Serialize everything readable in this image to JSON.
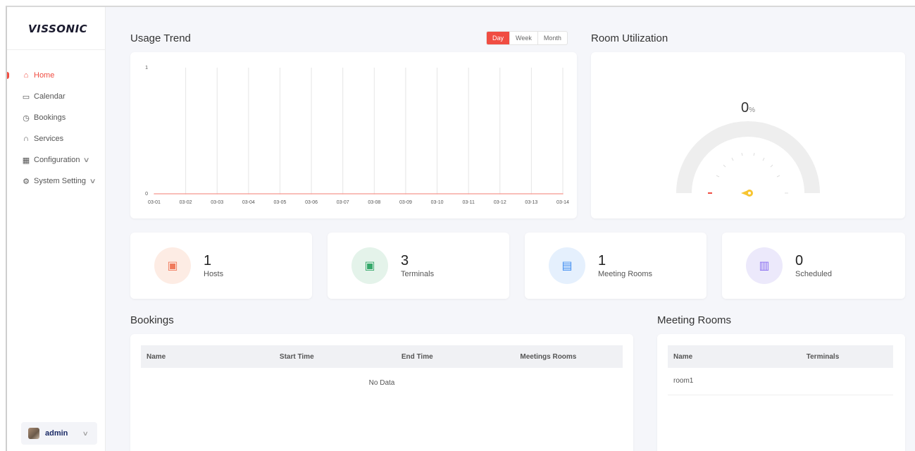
{
  "brand": {
    "logo": "VISSONIC"
  },
  "sidebar": {
    "items": [
      {
        "label": "Home",
        "icon": "home-icon",
        "glyph": "⌂",
        "active": true
      },
      {
        "label": "Calendar",
        "icon": "calendar-icon",
        "glyph": "▭",
        "active": false
      },
      {
        "label": "Bookings",
        "icon": "clock-icon",
        "glyph": "◷",
        "active": false
      },
      {
        "label": "Services",
        "icon": "headset-icon",
        "glyph": "∩",
        "active": false
      },
      {
        "label": "Configuration",
        "icon": "building-icon",
        "glyph": "▦",
        "active": false,
        "expandable": true
      },
      {
        "label": "System Setting",
        "icon": "settings-icon",
        "glyph": "⚙",
        "active": false,
        "expandable": true
      }
    ],
    "user": {
      "name": "admin"
    }
  },
  "usage_trend": {
    "title": "Usage Trend",
    "ranges": [
      "Day",
      "Week",
      "Month"
    ],
    "selected_range": "Day"
  },
  "chart_data": {
    "type": "line",
    "title": "Usage Trend",
    "xlabel": "",
    "ylabel": "",
    "categories": [
      "03-01",
      "03-02",
      "03-03",
      "03-04",
      "03-05",
      "03-06",
      "03-07",
      "03-08",
      "03-09",
      "03-10",
      "03-11",
      "03-12",
      "03-13",
      "03-14"
    ],
    "series": [
      {
        "values": [
          0,
          0,
          0,
          0,
          0,
          0,
          0,
          0,
          0,
          0,
          0,
          0,
          0,
          0
        ],
        "color": "#f7a8a2"
      }
    ],
    "y_ticks": [
      "0",
      "1"
    ],
    "ylim": [
      0,
      1
    ],
    "grid": "vertical"
  },
  "room_utilization": {
    "title": "Room Utilization",
    "value": "0",
    "unit": "%",
    "gauge_fraction": 0
  },
  "stats": [
    {
      "value": "1",
      "label": "Hosts",
      "icon": "host-monitor-icon",
      "glyph": "▣",
      "bg": "#fdece4",
      "fg": "#f07a5c"
    },
    {
      "value": "3",
      "label": "Terminals",
      "icon": "terminal-monitor-icon",
      "glyph": "▣",
      "bg": "#e4f3ea",
      "fg": "#35a86a"
    },
    {
      "value": "1",
      "label": "Meeting Rooms",
      "icon": "meeting-room-icon",
      "glyph": "▤",
      "bg": "#e5f0fd",
      "fg": "#3f8cf0"
    },
    {
      "value": "0",
      "label": "Scheduled",
      "icon": "presentation-board-icon",
      "glyph": "▥",
      "bg": "#ece9fb",
      "fg": "#8b6ff0"
    }
  ],
  "bookings": {
    "title": "Bookings",
    "columns": [
      "Name",
      "Start Time",
      "End Time",
      "Meetings Rooms"
    ],
    "rows": [],
    "empty_text": "No Data"
  },
  "meeting_rooms": {
    "title": "Meeting Rooms",
    "columns": [
      "Name",
      "Terminals"
    ],
    "rows": [
      {
        "name": "room1",
        "terminals": ""
      }
    ]
  },
  "colors": {
    "accent": "#f04d42",
    "background": "#f5f6fa"
  }
}
